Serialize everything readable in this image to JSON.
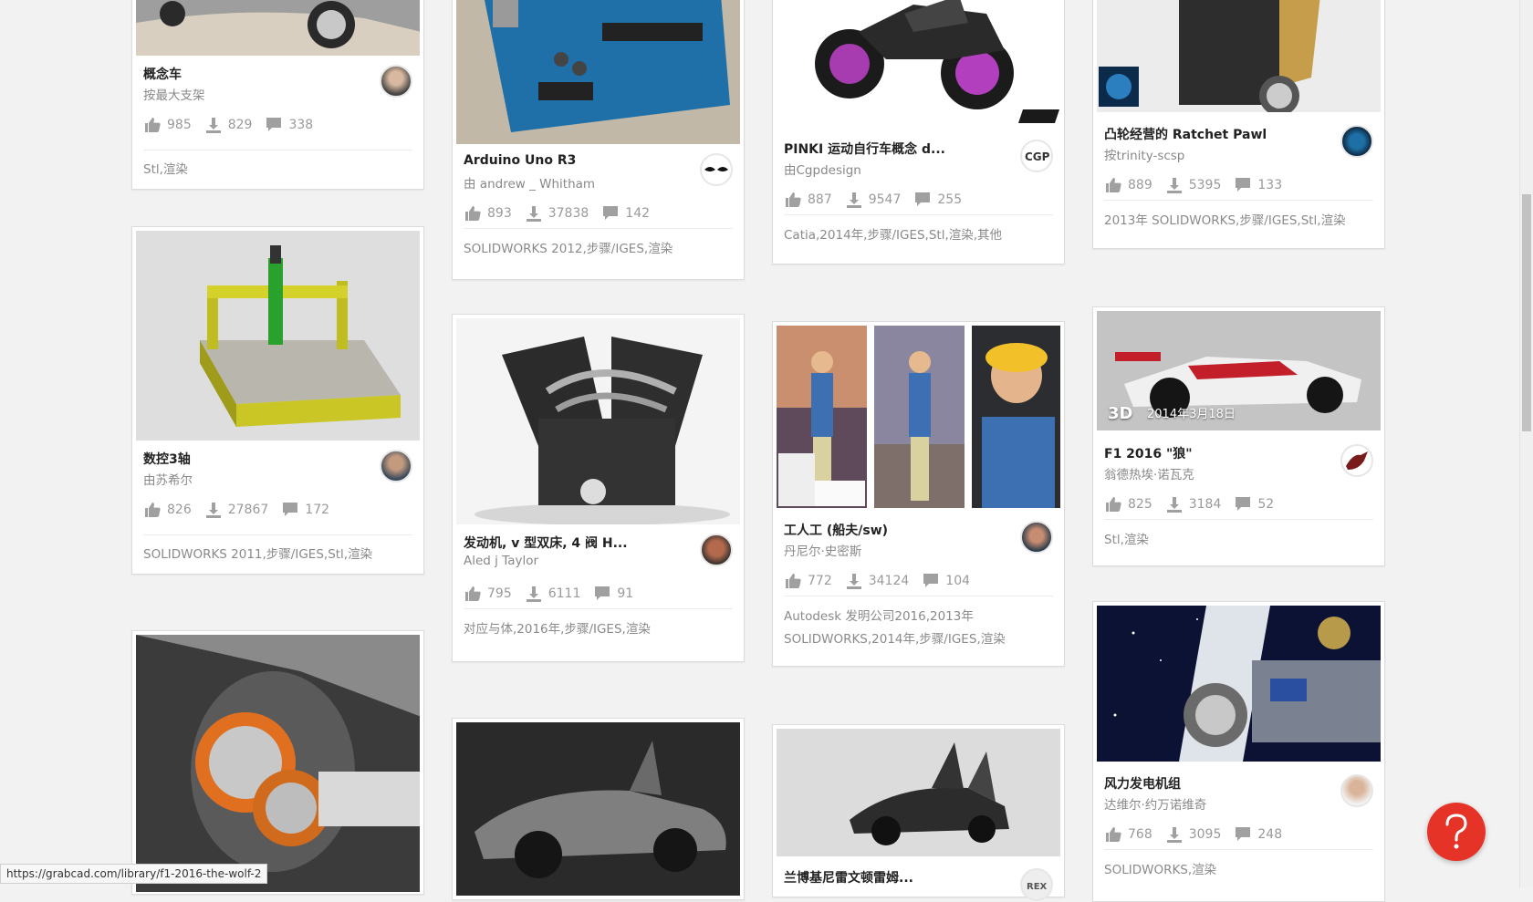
{
  "cards": [
    {
      "title": "概念车",
      "author": "按最大支架",
      "likes": "985",
      "downloads": "829",
      "comments": "338",
      "tags": "Stl,渲染",
      "image": "concept-car-image",
      "avatar": "user-avatar"
    },
    {
      "title": "数控3轴",
      "author": "由苏希尔",
      "likes": "826",
      "downloads": "27867",
      "comments": "172",
      "tags": "SOLIDWORKS 2011,步骤/IGES,Stl,渲染",
      "image": "cnc-router-image",
      "avatar": "user-avatar"
    },
    {
      "title": "Arduino Uno R3",
      "author": "由 andrew _ Whitham",
      "likes": "893",
      "downloads": "37838",
      "comments": "142",
      "tags": "SOLIDWORKS 2012,步骤/IGES,渲染",
      "image": "arduino-board-image",
      "avatar": "user-avatar"
    },
    {
      "title": "发动机, v 型双床, 4 阀 H...",
      "author": "Aled j Taylor",
      "likes": "795",
      "downloads": "6111",
      "comments": "91",
      "tags": "对应与体,2016年,步骤/IGES,渲染",
      "image": "v-twin-engine-image",
      "avatar": "user-avatar"
    },
    {
      "title": "PINKI 运动自行车概念 d...",
      "author": "由Cgpdesign",
      "likes": "887",
      "downloads": "9547",
      "comments": "255",
      "tags": "Catia,2014年,步骤/IGES,Stl,渲染,其他",
      "image": "motorbike-image",
      "avatar": "cgp-logo-avatar"
    },
    {
      "title": "工人工 (船夫/sw)",
      "author": "丹尼尔·史密斯",
      "likes": "772",
      "downloads": "34124",
      "comments": "104",
      "tags": "Autodesk 发明公司2016,2013年 SOLIDWORKS,2014年,步骤/IGES,渲染",
      "image": "worker-figure-image",
      "avatar": "user-avatar"
    },
    {
      "title": "凸轮经营的 Ratchet Pawl",
      "author": "按trinity-scsp",
      "likes": "889",
      "downloads": "5395",
      "comments": "133",
      "tags": "2013年 SOLIDWORKS,步骤/IGES,Stl,渲染",
      "image": "ratchet-pawl-image",
      "avatar": "user-avatar"
    },
    {
      "title": "F1 2016 \"狼\"",
      "author": "翁德热埃·诺瓦克",
      "likes": "825",
      "downloads": "3184",
      "comments": "52",
      "tags": "Stl,渲染",
      "image": "f1-car-image",
      "avatar": "user-avatar",
      "badge": "3D",
      "date": "2014年3月18日"
    },
    {
      "title": "风力发电机组",
      "author": "达维尔·约万诺维奇",
      "likes": "768",
      "downloads": "3095",
      "comments": "248",
      "tags": "SOLIDWORKS,渲染",
      "image": "wind-turbine-image",
      "avatar": "user-avatar"
    },
    {
      "title": "兰博基尼雷文顿雷姆...",
      "author": "",
      "likes": "",
      "downloads": "",
      "comments": "",
      "tags": "",
      "image": "lamborghini-image",
      "avatar": "rex-logo-avatar"
    },
    {
      "title": "",
      "author": "",
      "likes": "",
      "downloads": "",
      "comments": "",
      "tags": "",
      "image": "mclaren-image",
      "avatar": ""
    },
    {
      "title": "",
      "author": "",
      "likes": "",
      "downloads": "",
      "comments": "",
      "tags": "",
      "image": "gearbox-image",
      "avatar": ""
    }
  ],
  "status_url": "https://grabcad.com/library/f1-2016-the-wolf-2",
  "help_label": "?",
  "colors": {
    "accent": "#e53427",
    "background": "#f2f2f2"
  }
}
